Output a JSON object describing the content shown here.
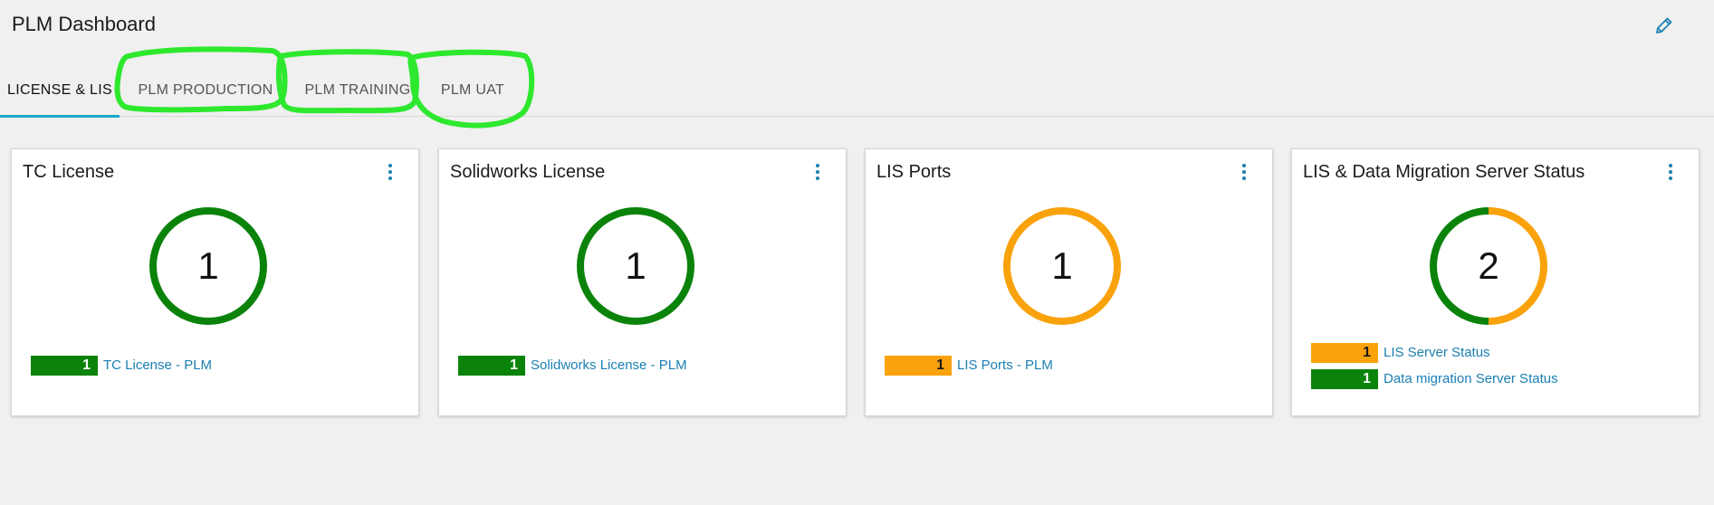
{
  "header": {
    "title": "PLM Dashboard",
    "edit_icon": "pencil-icon"
  },
  "tabs": [
    {
      "label": "LICENSE & LIS",
      "active": true
    },
    {
      "label": "PLM PRODUCTION",
      "active": false,
      "highlighted": true
    },
    {
      "label": "PLM TRAINING",
      "active": false,
      "highlighted": true
    },
    {
      "label": "PLM UAT",
      "active": false,
      "highlighted": true
    }
  ],
  "colors": {
    "green": "#0b830b",
    "orange": "#f9a20b",
    "link": "#1a7fb2",
    "tab_underline": "#19a9c9",
    "annotation": "#2ee82e"
  },
  "cards": [
    {
      "title": "TC License",
      "total": "1",
      "menu_icon": "kebab-menu-icon",
      "segments": [
        {
          "label": "TC License - PLM",
          "count": "1",
          "color": "green"
        }
      ]
    },
    {
      "title": "Solidworks License",
      "total": "1",
      "menu_icon": "kebab-menu-icon",
      "segments": [
        {
          "label": "Solidworks License - PLM",
          "count": "1",
          "color": "green"
        }
      ]
    },
    {
      "title": "LIS Ports",
      "total": "1",
      "menu_icon": "kebab-menu-icon",
      "segments": [
        {
          "label": "LIS Ports - PLM",
          "count": "1",
          "color": "orange"
        }
      ]
    },
    {
      "title": "LIS & Data Migration Server Status",
      "total": "2",
      "menu_icon": "kebab-menu-icon",
      "segments": [
        {
          "label": "LIS Server Status",
          "count": "1",
          "color": "orange"
        },
        {
          "label": "Data migration Server Status",
          "count": "1",
          "color": "green"
        }
      ]
    }
  ]
}
